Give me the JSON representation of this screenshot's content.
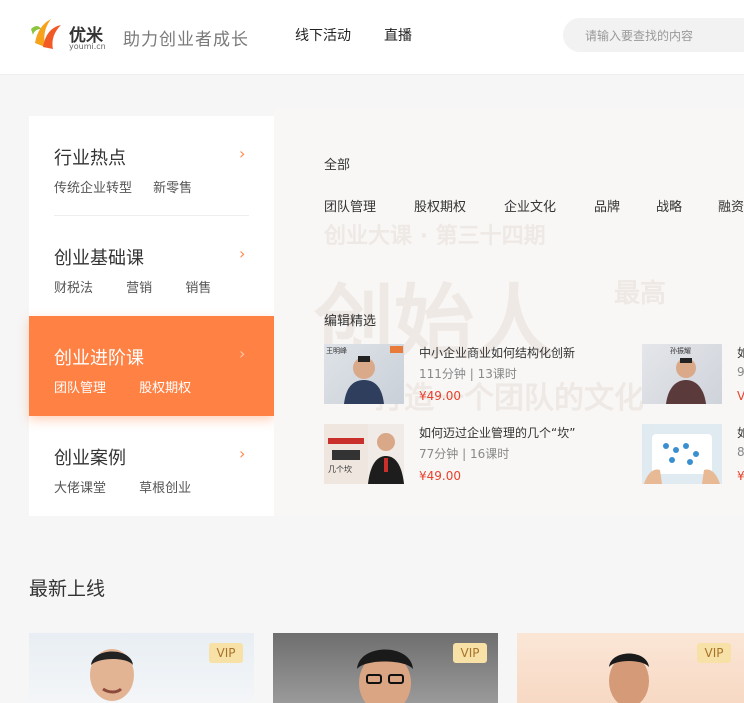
{
  "header": {
    "logo_cn": "优米",
    "logo_en": "youmi.cn",
    "slogan": "助力创业者成长",
    "nav": [
      "线下活动",
      "直播"
    ],
    "search_placeholder": "请输入要查找的内容"
  },
  "sidebar": {
    "categories": [
      {
        "title": "行业热点",
        "subs": [
          "传统企业转型",
          "新零售"
        ]
      },
      {
        "title": "创业基础课",
        "subs": [
          "财税法",
          "营销",
          "销售"
        ]
      },
      {
        "title": "创业进阶课",
        "subs": [
          "团队管理",
          "股权期权"
        ]
      },
      {
        "title": "创业案例",
        "subs": [
          "大佬课堂",
          "草根创业"
        ]
      }
    ],
    "chevron": "›"
  },
  "content": {
    "all_tab": "全部",
    "tags": [
      "团队管理",
      "股权期权",
      "企业文化",
      "品牌",
      "战略",
      "融资"
    ],
    "section_label": "编辑精选",
    "courses": [
      {
        "title": "中小企业商业如何结构化创新",
        "meta": "111分钟 | 13课时",
        "price": "¥49.00",
        "thumb_text": "王明峰"
      },
      {
        "title": "如何迈过企业管理的几个“坎”",
        "meta": "77分钟 | 16课时",
        "price": "¥49.00",
        "thumb_text": "几个坎"
      },
      {
        "title": "如",
        "meta": "9",
        "price": "V",
        "thumb_text": "孙振耀"
      },
      {
        "title": "如",
        "meta": "8",
        "price": "¥",
        "thumb_text": ""
      }
    ]
  },
  "latest": {
    "title": "最新上线",
    "vip": "VIP"
  }
}
